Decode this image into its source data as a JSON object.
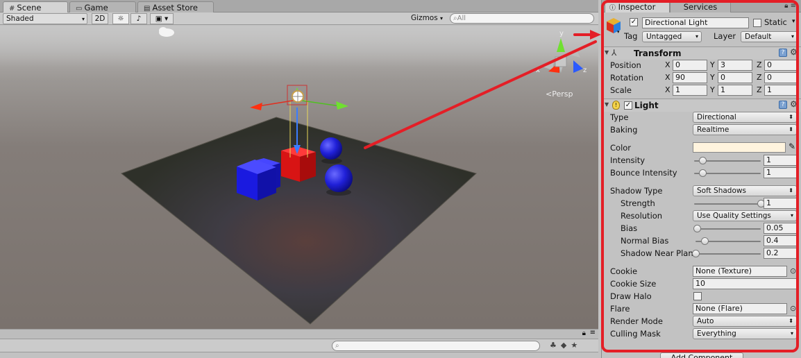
{
  "scene_tabs": [
    {
      "label": "Scene",
      "icon": "grid-icon"
    },
    {
      "label": "Game",
      "icon": "game-icon"
    },
    {
      "label": "Asset Store",
      "icon": "store-icon"
    }
  ],
  "scene_toolbar": {
    "shading_mode": "Shaded",
    "mode_2d": "2D",
    "gizmos_label": "Gizmos",
    "search_placeholder": "All"
  },
  "viewport": {
    "persp_label": "Persp",
    "axis_labels": {
      "x": "x",
      "y": "y",
      "z": "z"
    }
  },
  "inspector": {
    "tabs": [
      {
        "label": "Inspector",
        "active": true
      },
      {
        "label": "Services",
        "active": false
      }
    ],
    "object": {
      "name": "Directional Light",
      "active": true,
      "static_label": "Static",
      "static_checked": false,
      "tag_label": "Tag",
      "tag_value": "Untagged",
      "layer_label": "Layer",
      "layer_value": "Default"
    },
    "transform": {
      "title": "Transform",
      "rows": [
        {
          "label": "Position",
          "x": "0",
          "y": "3",
          "z": "0"
        },
        {
          "label": "Rotation",
          "x": "90",
          "y": "0",
          "z": "0"
        },
        {
          "label": "Scale",
          "x": "1",
          "y": "1",
          "z": "1"
        }
      ]
    },
    "light": {
      "title": "Light",
      "enabled": true,
      "type_label": "Type",
      "type_value": "Directional",
      "baking_label": "Baking",
      "baking_value": "Realtime",
      "color_label": "Color",
      "color_value": "#fff4de",
      "intensity_label": "Intensity",
      "intensity_value": "1",
      "intensity_fraction": 0.125,
      "bounce_label": "Bounce Intensity",
      "bounce_value": "1",
      "bounce_fraction": 0.125,
      "shadow_type_label": "Shadow Type",
      "shadow_type_value": "Soft Shadows",
      "strength_label": "Strength",
      "strength_value": "1",
      "strength_fraction": 1.0,
      "resolution_label": "Resolution",
      "resolution_value": "Use Quality Settings",
      "bias_label": "Bias",
      "bias_value": "0.05",
      "bias_fraction": 0.025,
      "normal_bias_label": "Normal Bias",
      "normal_bias_value": "0.4",
      "normal_bias_fraction": 0.133,
      "near_plane_label": "Shadow Near Plane",
      "near_plane_value": "0.2",
      "near_plane_fraction": 0.0,
      "cookie_label": "Cookie",
      "cookie_value": "None (Texture)",
      "cookie_size_label": "Cookie Size",
      "cookie_size_value": "10",
      "draw_halo_label": "Draw Halo",
      "draw_halo_checked": false,
      "flare_label": "Flare",
      "flare_value": "None (Flare)",
      "render_mode_label": "Render Mode",
      "render_mode_value": "Auto",
      "culling_mask_label": "Culling Mask",
      "culling_mask_value": "Everything"
    },
    "add_component_label": "Add Component"
  },
  "colors": {
    "highlight": "#e41e26",
    "cube_blue": "#1a1ae0",
    "cube_red": "#d81414",
    "sphere_blue": "#2222dd",
    "plane": "#3d3a33"
  }
}
